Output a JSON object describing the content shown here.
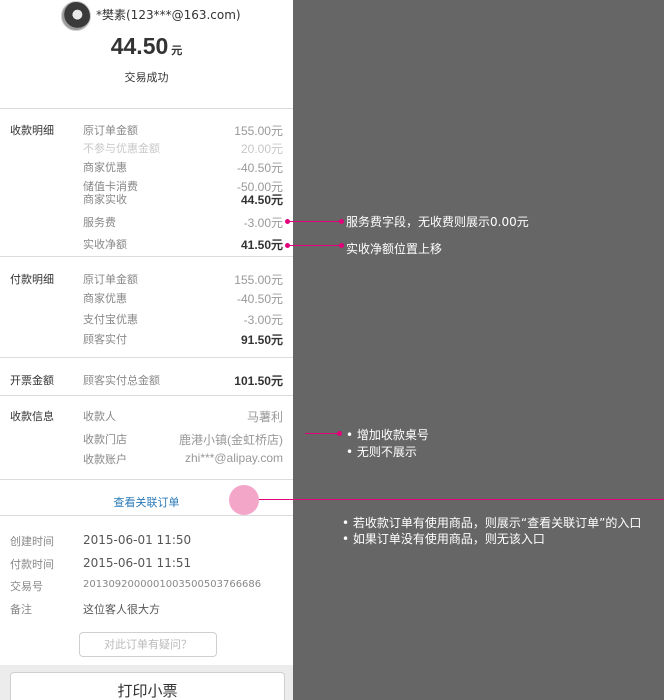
{
  "header": {
    "user_name": "*樊素(123***@163.com)",
    "amount": "44.50",
    "currency": "元",
    "status": "交易成功"
  },
  "receive_detail": {
    "section_label": "收款明细",
    "rows": [
      {
        "label": "原订单金额",
        "value": "155.00元"
      },
      {
        "label": "不参与优惠金额",
        "value": "20.00元"
      },
      {
        "label": "商家优惠",
        "value": "-40.50元"
      },
      {
        "label": "储值卡消费",
        "value": "-50.00元"
      },
      {
        "label": "商家实收",
        "value": "44.50元"
      },
      {
        "label": "服务费",
        "value": "-3.00元"
      },
      {
        "label": "实收净额",
        "value": "41.50元"
      }
    ]
  },
  "pay_detail": {
    "section_label": "付款明细",
    "rows": [
      {
        "label": "原订单金额",
        "value": "155.00元"
      },
      {
        "label": "商家优惠",
        "value": "-40.50元"
      },
      {
        "label": "支付宝优惠",
        "value": "-3.00元"
      },
      {
        "label": "顾客实付",
        "value": "91.50元"
      }
    ]
  },
  "invoice": {
    "section_label": "开票金额",
    "label": "顾客实付总金额",
    "value": "101.50元"
  },
  "receive_info": {
    "section_label": "收款信息",
    "rows": [
      {
        "label": "收款人",
        "value": "马薯利"
      },
      {
        "label": "收款门店",
        "value": "鹿港小镇(金虹桥店)"
      },
      {
        "label": "收款账户",
        "value": "zhi***@alipay.com"
      }
    ]
  },
  "related_order_link": "查看关联订单",
  "meta": [
    {
      "label": "创建时间",
      "value": "2015-06-01 11:50"
    },
    {
      "label": "付款时间",
      "value": "2015-06-01 11:51"
    },
    {
      "label": "交易号",
      "value": "2013092000001003500503766686"
    },
    {
      "label": "备注",
      "value": "这位客人很大方"
    }
  ],
  "question_button": "对此订单有疑问？",
  "print_button": "打印小票",
  "annotations": {
    "service_fee": "服务费字段，无收费则展示0.00元",
    "net_amount": "实收净额位置上移",
    "table_line1": "• 增加收款桌号",
    "table_line2": "• 无则不展示",
    "link_line1": "• 若收款订单有使用商品，则展示“查看关联订单”的入口",
    "link_line2": "• 如果订单没有使用商品，则无该入口"
  },
  "colors": {
    "background": "#666666",
    "annotation_accent": "#e2007a",
    "link": "#2a7ab8"
  }
}
